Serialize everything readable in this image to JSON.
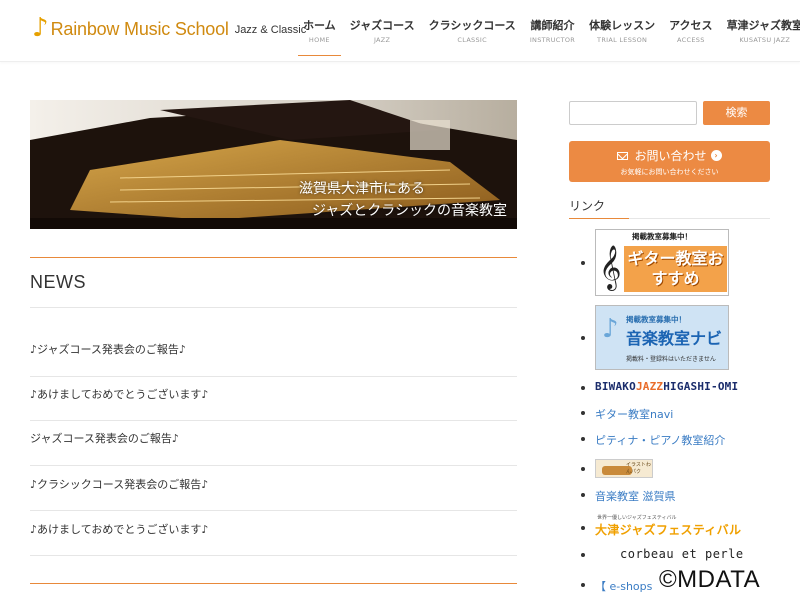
{
  "header": {
    "logo_note": "♪",
    "logo_title": "Rainbow Music School",
    "logo_sub": "Jazz & Classic",
    "nav": [
      {
        "jp": "ホーム",
        "en": "HOME"
      },
      {
        "jp": "ジャズコース",
        "en": "JAZZ"
      },
      {
        "jp": "クラシックコース",
        "en": "CLASSIC"
      },
      {
        "jp": "講師紹介",
        "en": "INSTRUCTOR"
      },
      {
        "jp": "体験レッスン",
        "en": "TRIAL LESSON"
      },
      {
        "jp": "アクセス",
        "en": "ACCESS"
      },
      {
        "jp": "草津ジャズ教室",
        "en": "KUSATSU JAZZ"
      }
    ]
  },
  "hero": {
    "line1": "滋賀県大津市にある",
    "line2": "ジャズとクラシックの音楽教室"
  },
  "news": {
    "title": "NEWS",
    "items": [
      "♪ジャズコース発表会のご報告♪",
      "♪あけましておめでとうございます♪",
      "ジャズコース発表会のご報告♪",
      "♪クラシックコース発表会のご報告♪",
      "♪あけましておめでとうございます♪"
    ]
  },
  "sidebar": {
    "search_placeholder": "",
    "search_button": "検索",
    "contact_main": "お問い合わせ",
    "contact_sub": "お気軽にお問い合わせください",
    "links_title": "リンク",
    "guitar_banner_top": "掲載教室募集中！",
    "guitar_banner_main": "ギター教室おすすめ",
    "navi_banner_top": "掲載教室募集中！",
    "navi_banner_main": "音楽教室ナビ",
    "navi_banner_sub": "掲載料・登録料はいただきません",
    "biwako_1": "BIWAKO",
    "biwako_2": "JAZZ",
    "biwako_3": "HIGASHI-OMI",
    "link_guitar_navi": "ギター教室navi",
    "link_pitina": "ピティナ・ピアノ教室紹介",
    "small_img_text": "イラストわんパク",
    "link_shiga": "音楽教室 滋賀県",
    "jazzfes_top": "世界一優しいジャズフェスティバル",
    "jazzfes_main": "大津ジャズフェスティバル",
    "corbeau": "corbeau et perle",
    "eshop": "【 e-shops"
  },
  "watermark": "©MDATA",
  "colors": {
    "accent": "#ec8a43",
    "link": "#3a7cc4",
    "logo": "#d08a10"
  }
}
